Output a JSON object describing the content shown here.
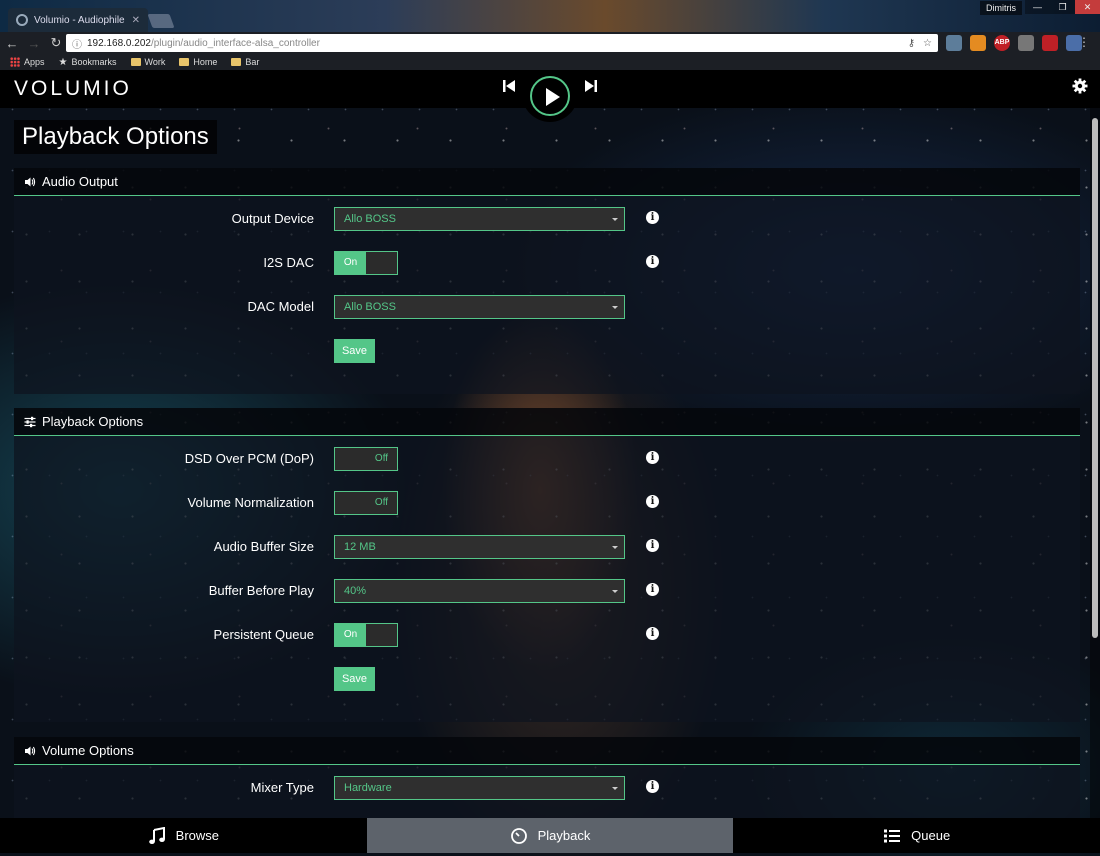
{
  "browser": {
    "tab_title": "Volumio - Audiophile M",
    "tab_close": "✕",
    "user": "Dimitris",
    "win_min": "—",
    "win_max": "❐",
    "win_close": "✕",
    "url_host": "192.168.0.202",
    "url_path": "/plugin/audio_interface-alsa_controller",
    "bookmarks": [
      "Apps",
      "Bookmarks",
      "Work",
      "Home",
      "Bar"
    ],
    "extensions": [
      "",
      "",
      "ABP",
      "",
      "",
      ""
    ]
  },
  "app": {
    "logo": "volumio",
    "page_title": "Playback Options",
    "colors": {
      "accent": "#54c688",
      "header": "#000000",
      "active_tab": "#5d636b"
    }
  },
  "sections": {
    "audio_output": {
      "title": "Audio Output",
      "output_device": {
        "label": "Output Device",
        "value": "Allo BOSS"
      },
      "i2s_dac": {
        "label": "I2S DAC",
        "state": "On"
      },
      "dac_model": {
        "label": "DAC Model",
        "value": "Allo BOSS"
      },
      "save_label": "Save"
    },
    "playback_options": {
      "title": "Playback Options",
      "dsd_over_pcm": {
        "label": "DSD Over PCM (DoP)",
        "state": "Off"
      },
      "volume_normalization": {
        "label": "Volume Normalization",
        "state": "Off"
      },
      "audio_buffer_size": {
        "label": "Audio Buffer Size",
        "value": "12 MB"
      },
      "buffer_before_play": {
        "label": "Buffer Before Play",
        "value": "40%"
      },
      "persistent_queue": {
        "label": "Persistent Queue",
        "state": "On"
      },
      "save_label": "Save"
    },
    "volume_options": {
      "title": "Volume Options",
      "mixer_type": {
        "label": "Mixer Type",
        "value": "Hardware"
      }
    }
  },
  "footer": {
    "browse": "Browse",
    "playback": "Playback",
    "queue": "Queue"
  }
}
